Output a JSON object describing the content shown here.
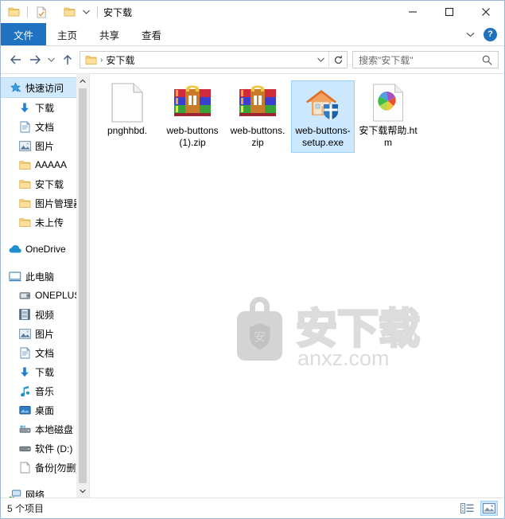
{
  "window": {
    "title": "安下载",
    "quick_access": [
      {
        "name": "folder-icon",
        "label": "文件夹"
      },
      {
        "name": "properties-icon",
        "label": "属性"
      },
      {
        "name": "new-folder-icon",
        "label": "新建文件夹"
      }
    ],
    "qat_dropdown": "▾",
    "controls": {
      "minimize": "—",
      "maximize": "□",
      "close": "✕"
    }
  },
  "ribbon": {
    "tabs": [
      {
        "label": "文件",
        "active": true
      },
      {
        "label": "主页",
        "active": false
      },
      {
        "label": "共享",
        "active": false
      },
      {
        "label": "查看",
        "active": false
      }
    ],
    "collapse": "⌄",
    "help": "?"
  },
  "navigation": {
    "back": "←",
    "forward": "→",
    "recent": "⌄",
    "up": "↑",
    "address": {
      "crumb": "安下载",
      "separator": "›",
      "dropdown": "⌄",
      "refresh": "↻"
    },
    "search": {
      "placeholder": "搜索\"安下载\"",
      "icon": "search-icon"
    }
  },
  "sidebar": {
    "items": [
      {
        "label": "快速访问",
        "icon": "star-pin-icon",
        "indent": 0,
        "selected": true,
        "pinned": false
      },
      {
        "label": "下载",
        "icon": "download-arrow-icon",
        "indent": 1,
        "selected": false,
        "pinned": true
      },
      {
        "label": "文档",
        "icon": "document-icon",
        "indent": 1,
        "selected": false,
        "pinned": true
      },
      {
        "label": "图片",
        "icon": "pictures-icon",
        "indent": 1,
        "selected": false,
        "pinned": true
      },
      {
        "label": "AAAAA",
        "icon": "folder-icon",
        "indent": 1,
        "selected": false,
        "pinned": false
      },
      {
        "label": "安下载",
        "icon": "folder-icon",
        "indent": 1,
        "selected": false,
        "pinned": false
      },
      {
        "label": "图片管理器",
        "icon": "folder-icon",
        "indent": 1,
        "selected": false,
        "pinned": false
      },
      {
        "label": "未上传",
        "icon": "folder-icon",
        "indent": 1,
        "selected": false,
        "pinned": false
      },
      {
        "label": "OneDrive",
        "icon": "cloud-icon",
        "indent": 0,
        "selected": false,
        "pinned": false,
        "gap_before": true
      },
      {
        "label": "此电脑",
        "icon": "computer-icon",
        "indent": 0,
        "selected": false,
        "pinned": false,
        "gap_before": true
      },
      {
        "label": "ONEPLUS",
        "icon": "phone-icon",
        "indent": 1,
        "selected": false,
        "pinned": false
      },
      {
        "label": "视频",
        "icon": "video-icon",
        "indent": 1,
        "selected": false,
        "pinned": false
      },
      {
        "label": "图片",
        "icon": "pictures-icon",
        "indent": 1,
        "selected": false,
        "pinned": false
      },
      {
        "label": "文档",
        "icon": "document-icon",
        "indent": 1,
        "selected": false,
        "pinned": false
      },
      {
        "label": "下载",
        "icon": "download-arrow-icon",
        "indent": 1,
        "selected": false,
        "pinned": false
      },
      {
        "label": "音乐",
        "icon": "music-icon",
        "indent": 1,
        "selected": false,
        "pinned": false
      },
      {
        "label": "桌面",
        "icon": "desktop-icon",
        "indent": 1,
        "selected": false,
        "pinned": false
      },
      {
        "label": "本地磁盘 (C",
        "icon": "local-disk-icon",
        "indent": 1,
        "selected": false,
        "pinned": false
      },
      {
        "label": "软件 (D:)",
        "icon": "drive-icon",
        "indent": 1,
        "selected": false,
        "pinned": false
      },
      {
        "label": "备份[勿删]",
        "icon": "backup-drive-icon",
        "indent": 1,
        "selected": false,
        "pinned": false
      },
      {
        "label": "网络",
        "icon": "network-icon",
        "indent": 0,
        "selected": false,
        "pinned": false,
        "gap_before": true
      }
    ],
    "scrollbar": {
      "up": "⌃",
      "down": "⌄"
    }
  },
  "files": [
    {
      "name": "pnghhbd.",
      "icon": "blank-document-icon",
      "selected": false
    },
    {
      "name": "web-buttons (1).zip",
      "icon": "winrar-archive-icon",
      "selected": false
    },
    {
      "name": "web-buttons.zip",
      "icon": "winrar-archive-icon",
      "selected": false
    },
    {
      "name": "web-buttons-setup.exe",
      "icon": "house-shield-installer-icon",
      "selected": true
    },
    {
      "name": "安下载帮助.htm",
      "icon": "html-pinwheel-icon",
      "selected": false
    }
  ],
  "watermark": {
    "text": "安",
    "brand": "安下载",
    "domain": "anxz.com"
  },
  "statusbar": {
    "item_count": "5 个项目",
    "views": [
      {
        "name": "details-view-button",
        "active": false
      },
      {
        "name": "large-icons-view-button",
        "active": true
      }
    ]
  },
  "colors": {
    "accent": "#1f72c0",
    "selection_fill": "#cce8ff",
    "selection_border": "#99d1ff",
    "nav_selection": "#cfe8fb",
    "folder_yellow": "#fcd775"
  }
}
